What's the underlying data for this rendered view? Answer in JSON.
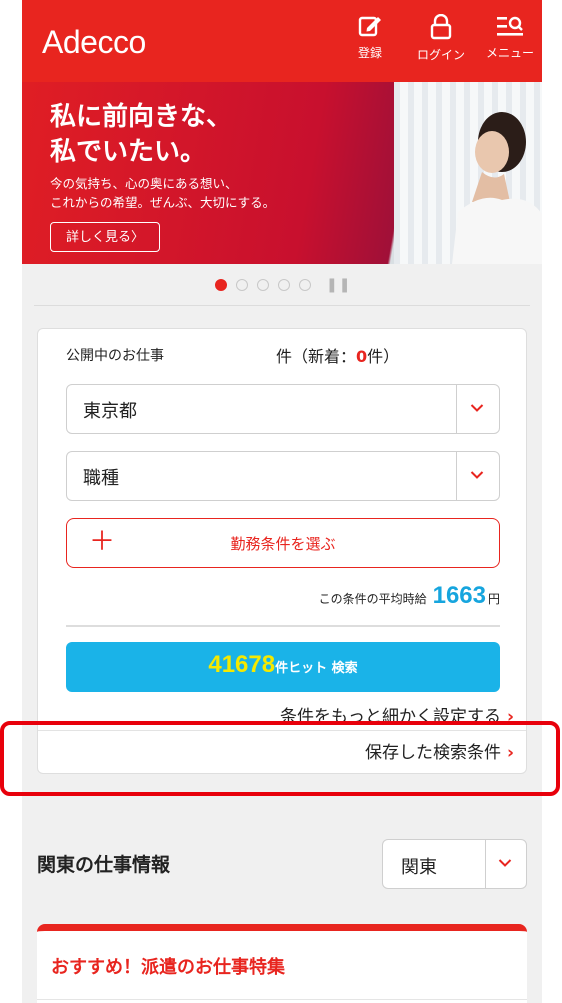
{
  "header": {
    "logo": "Adecco",
    "register_label": "登録",
    "login_label": "ログイン",
    "menu_label": "メニュー"
  },
  "hero": {
    "headline_1": "私に前向きな、",
    "headline_2": "私でいたい。",
    "sub_1": "今の気持ち、心の奥にある想い、",
    "sub_2": "これからの希望。ぜんぶ、大切にする。",
    "button_label": "詳しく見る〉"
  },
  "carousel": {
    "total_slides": 5,
    "active_index": 0
  },
  "search": {
    "published_label": "公開中のお仕事",
    "count_prefix": "件（新着：",
    "new_count": "0",
    "count_suffix": "件）",
    "prefecture_value": "東京都",
    "job_type_value": "職種",
    "conditions_label": "勤務条件を選ぶ",
    "plus_symbol": "＋",
    "avg_label": "この条件の平均時給",
    "avg_value": "1663",
    "avg_unit": "円",
    "hit_count": "41678",
    "hit_suffix": "件ヒット 検索",
    "detail_link": "条件をもっと細かく設定する",
    "saved_link": "保存した検索条件",
    "chevron": "›"
  },
  "region": {
    "title": "関東の仕事情報",
    "selected": "関東"
  },
  "recommend": {
    "title": "おすすめ！派遣のお仕事特集"
  },
  "colors": {
    "brand_red": "#e8251f",
    "accent_blue": "#1ab3e8",
    "hit_yellow": "#f5e900",
    "avg_blue": "#16a5de"
  }
}
